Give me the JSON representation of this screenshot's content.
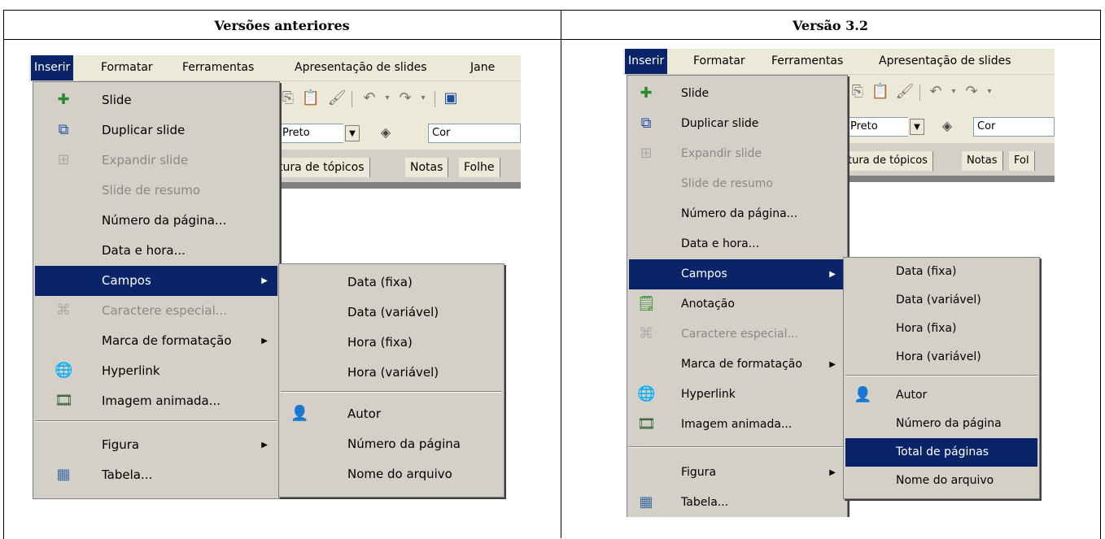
{
  "doc": {
    "col_left_title": "Versões anteriores",
    "col_right_title": "Versão 3.2"
  },
  "left": {
    "menubar": [
      "Inserir",
      "Formatar",
      "Ferramentas",
      "Apresentação de slides",
      "Jane"
    ],
    "toolbar": {
      "color_value": "Preto",
      "color_label": "Cor"
    },
    "tabs": [
      "tura de tópicos",
      "Notas",
      "Folhe"
    ],
    "menu": [
      {
        "label": "Slide",
        "icon": "slide-add-icon"
      },
      {
        "label": "Duplicar slide",
        "icon": "duplicate-slide-icon"
      },
      {
        "label": "Expandir slide",
        "icon": "expand-slide-icon",
        "disabled": true
      },
      {
        "label": "Slide de resumo",
        "disabled": true
      },
      {
        "label": "Número da página..."
      },
      {
        "label": "Data e hora..."
      },
      {
        "label": "Campos",
        "highlighted": true,
        "submenu": true
      },
      {
        "label": "Caractere especial...",
        "icon": "special-character-icon",
        "disabled": true
      },
      {
        "label": "Marca de formatação",
        "submenu": true
      },
      {
        "label": "Hyperlink",
        "icon": "hyperlink-icon"
      },
      {
        "label": "Imagem animada...",
        "icon": "animated-image-icon"
      },
      {
        "label": "Figura",
        "submenu": true
      },
      {
        "label": "Tabela...",
        "icon": "table-icon"
      }
    ],
    "submenu": [
      {
        "label": "Data (fixa)"
      },
      {
        "label": "Data (variável)"
      },
      {
        "label": "Hora (fixa)"
      },
      {
        "label": "Hora (variável)"
      },
      {
        "label": "Autor",
        "icon": "author-icon"
      },
      {
        "label": "Número da página"
      },
      {
        "label": "Nome do arquivo"
      }
    ]
  },
  "right": {
    "menubar": [
      "Inserir",
      "Formatar",
      "Ferramentas",
      "Apresentação de slides"
    ],
    "toolbar": {
      "color_value": "Preto",
      "color_label": "Cor"
    },
    "tabs": [
      "tura de tópicos",
      "Notas",
      "Fol"
    ],
    "menu": [
      {
        "label": "Slide",
        "icon": "slide-add-icon"
      },
      {
        "label": "Duplicar slide",
        "icon": "duplicate-slide-icon"
      },
      {
        "label": "Expandir slide",
        "icon": "expand-slide-icon",
        "disabled": true
      },
      {
        "label": "Slide de resumo",
        "disabled": true
      },
      {
        "label": "Número da página..."
      },
      {
        "label": "Data e hora..."
      },
      {
        "label": "Campos",
        "highlighted": true,
        "submenu": true
      },
      {
        "label": "Anotação",
        "icon": "annotation-icon"
      },
      {
        "label": "Caractere especial...",
        "icon": "special-character-icon",
        "disabled": true
      },
      {
        "label": "Marca de formatação",
        "submenu": true
      },
      {
        "label": "Hyperlink",
        "icon": "hyperlink-icon"
      },
      {
        "label": "Imagem animada...",
        "icon": "animated-image-icon"
      },
      {
        "label": "Figura",
        "submenu": true
      },
      {
        "label": "Tabela...",
        "icon": "table-icon"
      }
    ],
    "submenu": [
      {
        "label": "Data (fixa)"
      },
      {
        "label": "Data (variável)"
      },
      {
        "label": "Hora (fixa)"
      },
      {
        "label": "Hora (variável)"
      },
      {
        "label": "Autor",
        "icon": "author-icon"
      },
      {
        "label": "Número da página"
      },
      {
        "label": "Total de páginas",
        "highlighted": true
      },
      {
        "label": "Nome do arquivo"
      }
    ]
  }
}
